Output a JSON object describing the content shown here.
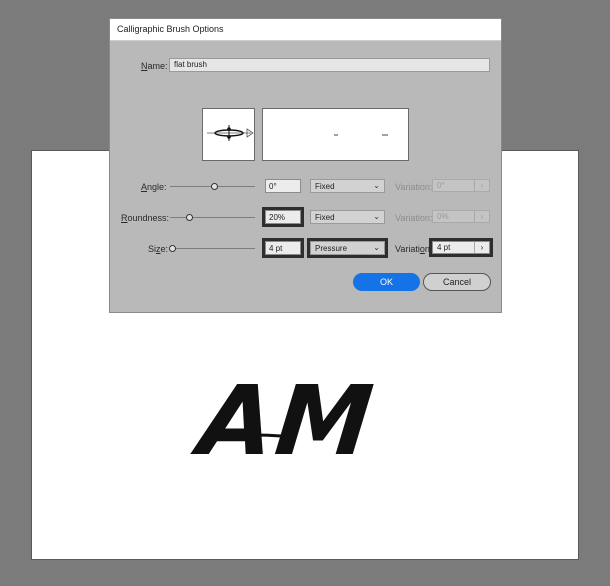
{
  "dialog": {
    "title": "Calligraphic Brush Options",
    "name_label_key": "N",
    "name_label_rest": "ame:",
    "name_value": "flat brush",
    "ok_label": "OK",
    "cancel_label": "Cancel"
  },
  "rows": {
    "angle": {
      "label_key": "A",
      "label_rest": "ngle:",
      "value": "0°",
      "mode": "Fixed",
      "variation_label": "Variation:",
      "variation_value": "0°",
      "slider_level": 0.5
    },
    "roundness": {
      "label_key": "R",
      "label_rest": "oundness:",
      "value": "20%",
      "mode": "Fixed",
      "variation_label": "Variation:",
      "variation_value": "0%",
      "slider_level": 0.2
    },
    "size": {
      "label_key_pre": "Si",
      "label_key": "z",
      "label_rest": "e:",
      "value": "4 pt",
      "mode": "Pressure",
      "variation_label_pre": "Variati",
      "variation_label_key": "o",
      "variation_label_rest": "n:",
      "variation_value": "4 pt",
      "slider_level": 0.0
    }
  },
  "icons": {
    "dropdown": "chevron-down-icon",
    "stepper": "chevron-right-icon"
  },
  "artboard": {
    "text": "AM"
  },
  "colors": {
    "canvas": "#7b7b7b",
    "dialog_bg": "#b9b9b9",
    "accent": "#1473e6",
    "highlight": "#2e2e2e"
  }
}
